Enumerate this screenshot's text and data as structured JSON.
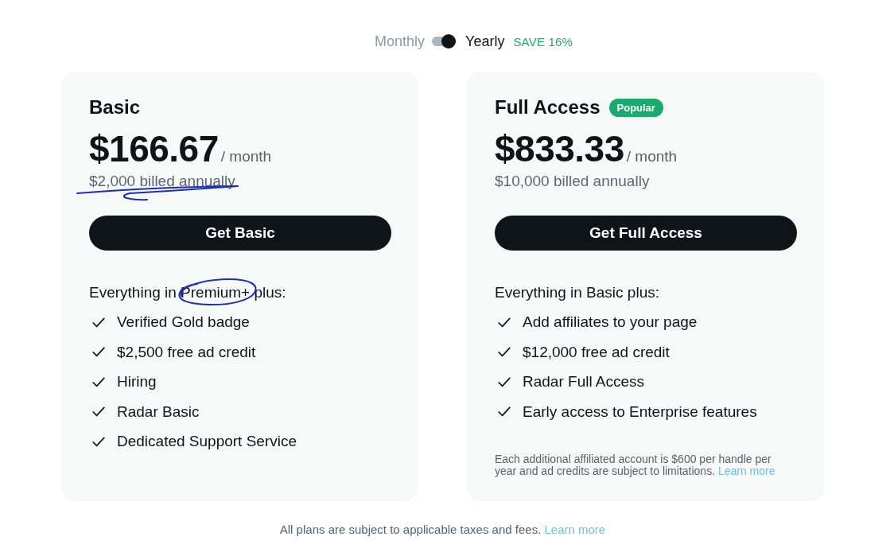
{
  "billing_toggle": {
    "options": [
      {
        "label": "Monthly",
        "selected": false
      },
      {
        "label": "Yearly",
        "selected": true
      }
    ],
    "on": true,
    "badge": "SAVE 16%"
  },
  "plans": [
    {
      "name": "Basic",
      "price": "$166.67",
      "period": "/ month",
      "billing": "$2,000 billed annually",
      "billing_underlined": true,
      "button": "Get Basic",
      "intro": "Everything in Premium+ plus:",
      "intro_circled": true,
      "features": [
        "Verified Gold badge",
        "$2,500 free ad credit",
        "Hiring",
        "Radar Basic",
        "Dedicated Support Service"
      ]
    },
    {
      "name": "Full Access",
      "badge": "Popular",
      "price": "$833.33",
      "period": "/ month",
      "billing": "$10,000 billed annually",
      "button": "Get Full Access",
      "intro": "Everything in Basic plus:",
      "features": [
        "Add affiliates to your page",
        "$12,000 free ad credit",
        "Radar Full Access",
        "Early access to Enterprise features"
      ],
      "note": {
        "text": "Each additional affiliated account is $600 per handle per year and ad credits are subject to limitations.",
        "link": "Learn more"
      }
    }
  ],
  "footer": {
    "text": "All plans are subject to applicable taxes and fees.",
    "link": "Learn more"
  }
}
